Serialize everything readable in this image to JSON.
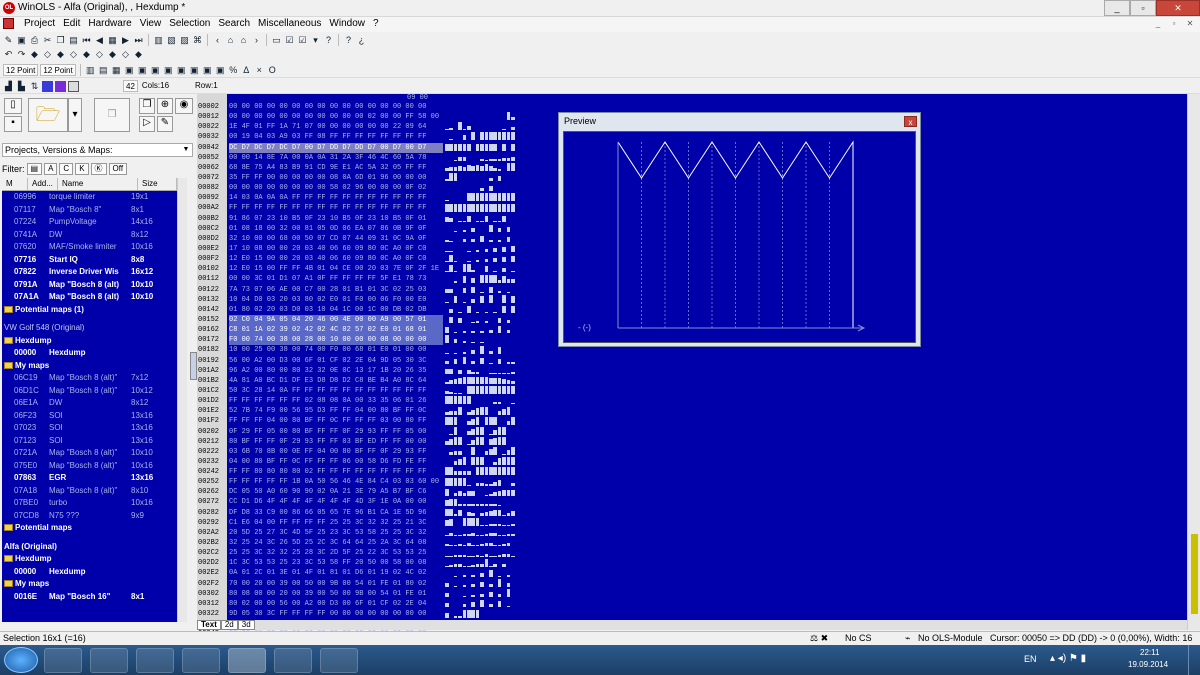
{
  "window": {
    "title": "WinOLS - Alfa (Original), , Hexdump *"
  },
  "menu": [
    "Project",
    "Edit",
    "Hardware",
    "View",
    "Selection",
    "Search",
    "Miscellaneous",
    "Window",
    "?"
  ],
  "toolbar3": {
    "font1": "12 Point",
    "font2": "12 Point",
    "cols_label": "Cols:16",
    "row_label": "Row:1",
    "offset_value": "42"
  },
  "left": {
    "combo_value": "Projects, Versions & Maps:",
    "filter_label": "Filter:",
    "filter_off": "Off",
    "headers": [
      "M",
      "Add...",
      "Name",
      "Size"
    ],
    "rows1": [
      {
        "a": "06996",
        "n": "torque limiter",
        "s": "19x1",
        "b": false
      },
      {
        "a": "07117",
        "n": "Map \"Bosch 8\"",
        "s": "8x1",
        "b": false
      },
      {
        "a": "07224",
        "n": "PumpVoltage",
        "s": "14x16",
        "b": false
      },
      {
        "a": "0741A",
        "n": "DW",
        "s": "8x12",
        "b": false
      },
      {
        "a": "07620",
        "n": "MAF/Smoke limiter",
        "s": "10x16",
        "b": false
      },
      {
        "a": "07716",
        "n": "Start IQ",
        "s": "8x8",
        "b": true
      },
      {
        "a": "07822",
        "n": "Inverse Driver Wis",
        "s": "16x12",
        "b": true
      },
      {
        "a": "0791A",
        "n": "Map \"Bosch 8 (alt)",
        "s": "10x10",
        "b": true
      },
      {
        "a": "07A1A",
        "n": "Map \"Bosch 8 (alt)",
        "s": "10x10",
        "b": true
      }
    ],
    "potential1": "Potential maps (1)",
    "project2": "VW Golf 548 (Original)",
    "hexdump_group": "Hexdump",
    "hexdump_row": {
      "a": "00000",
      "n": "Hexdump"
    },
    "mymaps": "My maps",
    "rows2": [
      {
        "a": "06C19",
        "n": "Map \"Bosch 8 (alt)\"",
        "s": "7x12",
        "b": false
      },
      {
        "a": "06D1C",
        "n": "Map \"Bosch 8 (alt)\"",
        "s": "10x12",
        "b": false
      },
      {
        "a": "06E1A",
        "n": "DW",
        "s": "8x12",
        "b": false
      },
      {
        "a": "06F23",
        "n": "SOI",
        "s": "13x16",
        "b": false
      },
      {
        "a": "07023",
        "n": "SOI",
        "s": "13x16",
        "b": false
      },
      {
        "a": "07123",
        "n": "SOI",
        "s": "13x16",
        "b": false
      },
      {
        "a": "0721A",
        "n": "Map \"Bosch 8 (alt)\"",
        "s": "10x10",
        "b": false
      },
      {
        "a": "075E0",
        "n": "Map \"Bosch 8 (alt)\"",
        "s": "10x16",
        "b": false
      },
      {
        "a": "07863",
        "n": "EGR",
        "s": "13x16",
        "b": true
      },
      {
        "a": "07A18",
        "n": "Map \"Bosch 8 (alt)\"",
        "s": "8x10",
        "b": false
      },
      {
        "a": "07BE0",
        "n": "turbo",
        "s": "10x16",
        "b": false
      },
      {
        "a": "07CD8",
        "n": "N75 ???",
        "s": "9x9",
        "b": false
      }
    ],
    "potential2": "Potential maps",
    "project3": "Alfa (Original)",
    "hexdump_group3": "Hexdump",
    "hexdump_row3": {
      "a": "00000",
      "n": "Hexdump"
    },
    "mymaps3": "My maps",
    "row3": {
      "a": "0016E",
      "n": "Map \"Bosch 16\"",
      "s": "8x1"
    }
  },
  "hex": {
    "top_value": "09 00",
    "addresses": [
      "00002",
      "00012",
      "00022",
      "00032",
      "00042",
      "00052",
      "00062",
      "00072",
      "00082",
      "00092",
      "000A2",
      "000B2",
      "000C2",
      "000D2",
      "000E2",
      "000F2",
      "00102",
      "00112",
      "00122",
      "00132",
      "00142",
      "00152",
      "00162",
      "00172",
      "00182",
      "00192",
      "001A2",
      "001B2",
      "001C2",
      "001D2",
      "001E2",
      "001F2",
      "00202",
      "00212",
      "00222",
      "00232",
      "00242",
      "00252",
      "00262",
      "00272",
      "00282",
      "00292",
      "002A2",
      "002B2",
      "002C2",
      "002D2",
      "002E2",
      "002F2",
      "00302",
      "00312",
      "00322",
      "00332",
      "00342",
      "00352",
      "00362"
    ],
    "lines": [
      "00 00 00 00 00 00 00 00 00 00 00 00 00 00 00 00",
      "00 00 00 00 00 00 00 00 00 00 00 02 00 00 FF 58 00",
      "1E 4F 01 FF 1A 71 07 00 00 00 00 00 00 22 09 64",
      "00 19 04 03 A9 03 FF 08 FF FF FF FF FF FF FF FF",
      "DC D7 DC D7 DC D7 00 D7 DD D7 DD D7 00 D7 00 D7",
      "00 00 14 8E 7A 00 0A 0A 31 2A 3F 46 4C 60 5A 78",
      "68 8E 75 A4 83 B9 91 CD 9E E1 AC 5A 32 05 FF FF",
      "35 FF FF 00 00 00 00 00 08 0A 6D 01 96 00 00 00",
      "00 00 00 00 00 00 00 00 58 02 96 00 00 00 0F 02",
      "14 03 0A 0A 0A FF FF FF FF FF FF FF FF FF FF FF",
      "FF FF FF FF FF FF FF FF FF FF FF FF FF FF FF FF",
      "91 86 07 23 10 B5 0F 23 10 B5 0F 23 10 B5 0F 01",
      "01 08 18 00 32 00 81 05 0D 06 EA 07 86 0B 9F 0F",
      "32 10 00 00 68 00 50 07 CD 07 44 09 31 0C 9A 0F",
      "17 10 08 00 00 20 03 40 06 60 09 80 0C A0 0F C0",
      "12 E0 15 00 00 20 03 40 06 60 09 80 0C A0 0F C0",
      "12 E0 15 00 FF FF 4B 01 04 CE 00 20 03 7E 0F 2F 1E",
      "00 00 3C 01 D1 07 A1 0F FF FF FF FF 5F E1 78 73",
      "7A 73 07 06 AE 00 C7 00 28 01 B1 01 3C 02 25 03",
      "10 04 D0 03 20 03 80 02 E0 01 F0 00 06 F0 00 E0",
      "01 80 02 20 03 D0 03 10 04 1C 00 1C 00 DB 02 DB",
      "02 C0 04 9A 05 04 20 46 00 4E 00 00 A9 00 57 01",
      "C8 01 1A 02 39 02 42 02 4C 02 57 02 E0 01 68 01",
      "F0 00 74 00 38 00 28 00 10 00 00 00 08 00 00 00",
      "10 00 25 00 38 00 74 00 F0 00 68 01 E0 01 00 00",
      "56 00 A2 00 D3 00 6F 01 CF 02 2E 04 9D 05 30 3C",
      "96 A2 00 80 00 80 32 32 0E 0C 13 17 1B 20 26 35",
      "4A 81 A0 BC D1 DF E3 D8 D8 D2 C8 BE B4 A0 8C 64",
      "50 3C 28 14 0A FF FF FF FF FF FF FF FF FF FF FF",
      "FF FF FF FF FF FF 02 08 08 0A 00 33 35 06 01 26",
      "52 7B 74 F9 00 56 95 D3 FF FF 04 00 80 BF FF 0C",
      "FF FF FF 04 00 80 BF FF 0C FF FF FF 03 00 80 FF",
      "0F 29 FF 05 00 80 BF FF FF 0F 29 93 FF FF 05 00",
      "80 BF FF FF 0F 29 93 FF FF 03 BF ED FF FF 00 00",
      "03 6B 70 8B 00 0E FF 04 00 80 BF FF 0F 29 93 FF",
      "04 00 80 BF FF 0C FF FF FF 06 00 58 D6 FD FE FF",
      "FF FF 80 80 80 80 02 FF FF FF FF FF FF FF FF FF",
      "FF FF FF FF FF 1B 0A 50 56 46 4E 84 C4 03 03 60 00",
      "DC 05 50 A0 60 90 90 02 0A 21 3E 79 A5 B7 BF C6",
      "CC D1 D6 4F 4F 4F 4F 4F 4F 4F 4D 3F 1E 0A 00 00",
      "DF D8 33 C9 00 86 66 05 65 7E 96 B1 CA 1E 5D 96",
      "C1 E6 04 00 FF FF FF FF 25 25 3C 32 32 25 21 3C",
      "20 5D 25 27 3C 4D 5F 25 23 3C 53 58 25 25 3C 32",
      "32 25 24 3C 26 5D 25 2C 3C 64 64 25 2A 3C 64 08",
      "25 25 3C 32 32 25 28 3C 2D 5F 25 22 3C 53 53 25",
      "1C 3C 53 53 25 23 3C 53 58 FF 20 50 00 58 00 08",
      "0A 01 2C 01 3E 01 4F 01 81 01 D6 01 19 02 4C 02",
      "70 00 20 00 39 00 50 00 9B 00 54 01 FE 01 80 02",
      "80 08 00 00 20 00 39 00 50 00 9B 00 54 01 FE 01",
      "80 02 00 00 56 00 A2 00 D3 00 6F 01 CF 02 2E 04",
      "9D 05 30 3C FF FF FF FF 00 00 00 00 00 00 00 00",
      "00 00 00 00 00 00 00 00 00 00 00 00 00 00 00 00",
      "00 00 00 00 00 00 00 00 00 00 00 00 00 00 00 00",
      "00 00 00 00 00 00 00 00 00 00 00 00 00 00 00 00",
      "00 00 00 00 00 00 00 00 00 00 00 00 00 00 00 00"
    ],
    "highlight_rows": [
      4
    ],
    "selection_rows": [
      21,
      22,
      23
    ]
  },
  "tabs": [
    "Text",
    "2d",
    "3d"
  ],
  "preview": {
    "title": "Preview",
    "axis_label": "- (-)",
    "close": "x"
  },
  "status": {
    "left": "Selection 16x1 (=16)",
    "cs": "No CS",
    "module": "No OLS-Module",
    "cursor": "Cursor: 00050 => DD (DD) -> 0 (0,00%), Width: 16"
  },
  "taskbar": {
    "lang": "EN",
    "time": "22:11",
    "date": "19.09.2014"
  }
}
